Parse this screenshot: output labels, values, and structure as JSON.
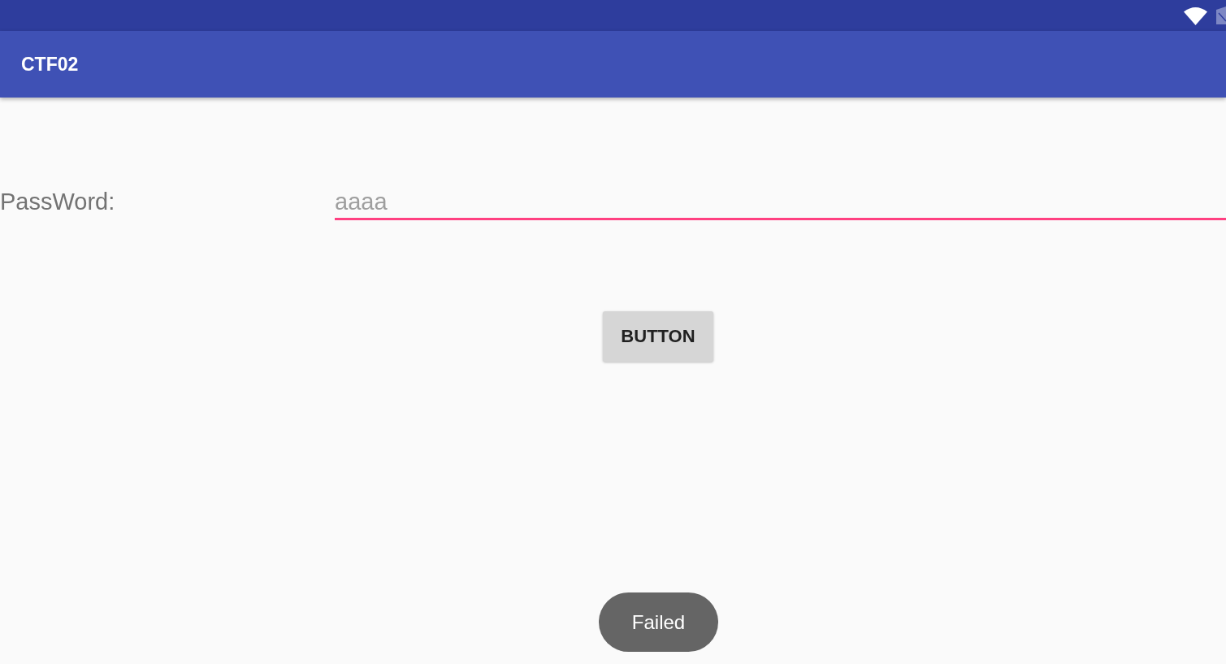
{
  "app_bar": {
    "title": "CTF02"
  },
  "form": {
    "label": "PassWord:",
    "password_field": {
      "placeholder": "aaaa",
      "focused": true
    }
  },
  "button": {
    "label": "BUTTON"
  },
  "toast": {
    "message": "Failed"
  }
}
